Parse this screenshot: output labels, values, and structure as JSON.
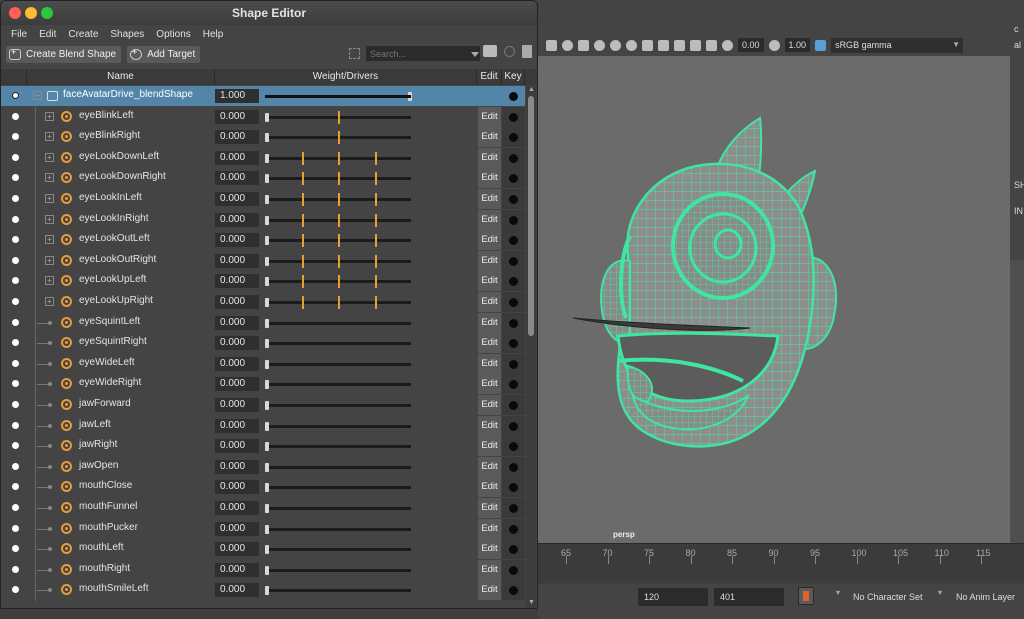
{
  "window": {
    "title": "Shape Editor"
  },
  "menu": [
    "File",
    "Edit",
    "Create",
    "Shapes",
    "Options",
    "Help"
  ],
  "toolbar": {
    "create_blend_label": "Create Blend Shape",
    "add_target_label": "Add Target",
    "search_placeholder": "Search..."
  },
  "columns": {
    "name": "Name",
    "weight": "Weight/Drivers",
    "edit": "Edit",
    "key": "Key"
  },
  "blend_shape": {
    "name": "faceAvatarDrive_blendShape",
    "weight": "1.000",
    "slider_value": 1.0
  },
  "edit_label": "Edit",
  "targets": [
    {
      "name": "eyeBlinkLeft",
      "weight": "0.000",
      "expandable": true,
      "keys": [
        0.5
      ]
    },
    {
      "name": "eyeBlinkRight",
      "weight": "0.000",
      "expandable": true,
      "keys": [
        0.5
      ]
    },
    {
      "name": "eyeLookDownLeft",
      "weight": "0.000",
      "expandable": true,
      "keys": [
        0.25,
        0.5,
        0.75
      ]
    },
    {
      "name": "eyeLookDownRight",
      "weight": "0.000",
      "expandable": true,
      "keys": [
        0.25,
        0.5,
        0.75
      ]
    },
    {
      "name": "eyeLookInLeft",
      "weight": "0.000",
      "expandable": true,
      "keys": [
        0.25,
        0.5,
        0.75
      ]
    },
    {
      "name": "eyeLookInRight",
      "weight": "0.000",
      "expandable": true,
      "keys": [
        0.25,
        0.5,
        0.75
      ]
    },
    {
      "name": "eyeLookOutLeft",
      "weight": "0.000",
      "expandable": true,
      "keys": [
        0.25,
        0.5,
        0.75
      ]
    },
    {
      "name": "eyeLookOutRight",
      "weight": "0.000",
      "expandable": true,
      "keys": [
        0.25,
        0.5,
        0.75
      ]
    },
    {
      "name": "eyeLookUpLeft",
      "weight": "0.000",
      "expandable": true,
      "keys": [
        0.25,
        0.5,
        0.75
      ]
    },
    {
      "name": "eyeLookUpRight",
      "weight": "0.000",
      "expandable": true,
      "keys": [
        0.25,
        0.5,
        0.75
      ]
    },
    {
      "name": "eyeSquintLeft",
      "weight": "0.000",
      "expandable": false,
      "keys": []
    },
    {
      "name": "eyeSquintRight",
      "weight": "0.000",
      "expandable": false,
      "keys": []
    },
    {
      "name": "eyeWideLeft",
      "weight": "0.000",
      "expandable": false,
      "keys": []
    },
    {
      "name": "eyeWideRight",
      "weight": "0.000",
      "expandable": false,
      "keys": []
    },
    {
      "name": "jawForward",
      "weight": "0.000",
      "expandable": false,
      "keys": []
    },
    {
      "name": "jawLeft",
      "weight": "0.000",
      "expandable": false,
      "keys": []
    },
    {
      "name": "jawRight",
      "weight": "0.000",
      "expandable": false,
      "keys": []
    },
    {
      "name": "jawOpen",
      "weight": "0.000",
      "expandable": false,
      "keys": []
    },
    {
      "name": "mouthClose",
      "weight": "0.000",
      "expandable": false,
      "keys": []
    },
    {
      "name": "mouthFunnel",
      "weight": "0.000",
      "expandable": false,
      "keys": []
    },
    {
      "name": "mouthPucker",
      "weight": "0.000",
      "expandable": false,
      "keys": []
    },
    {
      "name": "mouthLeft",
      "weight": "0.000",
      "expandable": false,
      "keys": []
    },
    {
      "name": "mouthRight",
      "weight": "0.000",
      "expandable": false,
      "keys": []
    },
    {
      "name": "mouthSmileLeft",
      "weight": "0.000",
      "expandable": false,
      "keys": []
    }
  ],
  "viewport": {
    "camera_label": "persp",
    "exposure": "0.00",
    "gamma": "1.00",
    "color_space": "sRGB gamma",
    "wire_color": "#3ee6a2",
    "right_strip_texts": [
      "c",
      "al",
      "SH",
      "IN"
    ]
  },
  "timeline": {
    "ticks": [
      "65",
      "70",
      "75",
      "80",
      "85",
      "90",
      "95",
      "100",
      "105",
      "110",
      "115"
    ]
  },
  "range": {
    "end_frame": "120",
    "max_frame": "401",
    "character_set": "No Character Set",
    "anim_layer": "No Anim Layer"
  }
}
